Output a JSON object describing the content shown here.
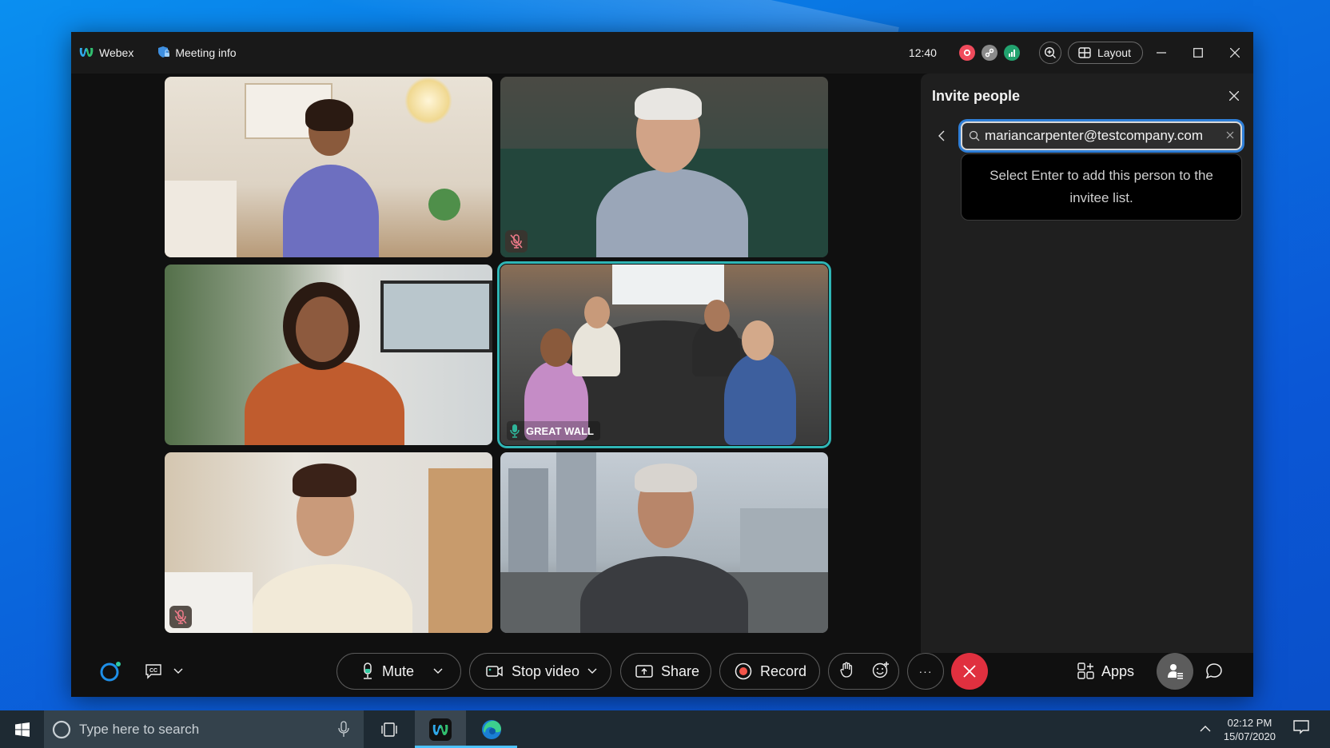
{
  "window": {
    "app_name": "Webex",
    "meeting_info_label": "Meeting info",
    "clock": "12:40",
    "layout_label": "Layout"
  },
  "colors": {
    "accent_blue": "#2f7fd8",
    "active_speaker": "#2fb5b5",
    "end_call_red": "#e0303f",
    "record_red": "#f2554a",
    "status_green": "#22a36f",
    "status_red": "#f04b5c"
  },
  "participants": [
    {
      "tile": "top-left",
      "muted": false,
      "label": ""
    },
    {
      "tile": "top-right",
      "muted": true,
      "label": ""
    },
    {
      "tile": "middle-left",
      "muted": false,
      "label": ""
    },
    {
      "tile": "middle-right",
      "muted": false,
      "label": "GREAT WALL",
      "active_speaker": true
    },
    {
      "tile": "bottom-left",
      "muted": true,
      "label": ""
    },
    {
      "tile": "bottom-right",
      "muted": false,
      "label": ""
    }
  ],
  "invite_panel": {
    "title": "Invite people",
    "search_value": "mariancarpenter@testcompany.com",
    "suggestion": "Select Enter to add this person to the invitee list."
  },
  "toolbar": {
    "mute_label": "Mute",
    "stop_video_label": "Stop video",
    "share_label": "Share",
    "record_label": "Record",
    "more_label": "···",
    "apps_label": "Apps"
  },
  "taskbar": {
    "search_placeholder": "Type here to search",
    "time": "02:12 PM",
    "date": "15/07/2020"
  }
}
